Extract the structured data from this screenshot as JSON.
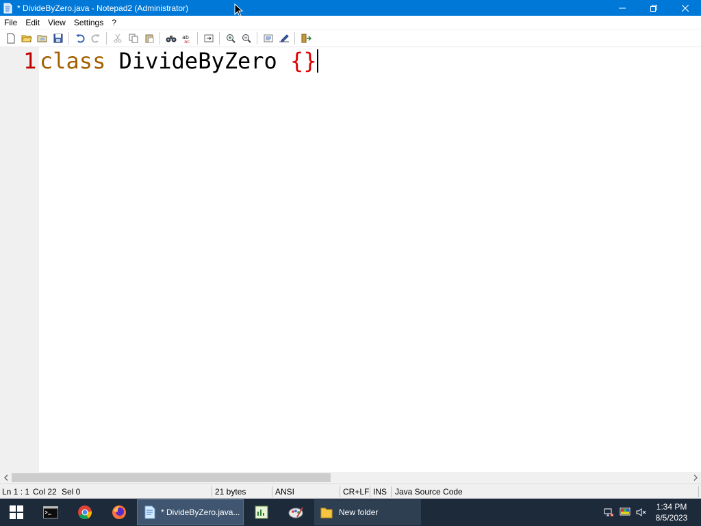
{
  "window": {
    "title": "* DivideByZero.java - Notepad2 (Administrator)",
    "controls": {
      "minimize_icon": "minimize-icon",
      "restore_icon": "restore-icon",
      "close_icon": "close-icon"
    }
  },
  "menu": [
    {
      "label": "File"
    },
    {
      "label": "Edit"
    },
    {
      "label": "View"
    },
    {
      "label": "Settings"
    },
    {
      "label": "?"
    }
  ],
  "toolbar": {
    "buttons": [
      "new",
      "open",
      "browse",
      "save",
      "undo",
      "redo",
      "cut",
      "copy",
      "paste",
      "find",
      "replace",
      "goto",
      "zoom-in",
      "zoom-out",
      "view-word-wrap",
      "settings-edit",
      "exit"
    ]
  },
  "editor": {
    "line_number": "1",
    "code": {
      "keyword": "class",
      "space1": " ",
      "identifier": "DivideByZero",
      "space2": " ",
      "brace_open": "{",
      "brace_close": "}"
    }
  },
  "statusbar": {
    "position": "Ln 1 : 1",
    "column": "Col 22",
    "selection": "Sel 0",
    "size": "21 bytes",
    "encoding": "ANSI",
    "line_endings": "CR+LF",
    "mode": "INS",
    "language": "Java Source Code"
  },
  "taskbar": {
    "tasks": [
      {
        "label": "* DivideByZero.java..."
      },
      {
        "label": "New folder"
      }
    ],
    "clock": {
      "time": "1:34 PM",
      "date": "8/5/2023"
    }
  },
  "colors": {
    "titlebar": "#0078d7",
    "keyword": "#a46000",
    "brace": "#e00000",
    "line_number": "#c00000",
    "taskbar": "#1d2a3a"
  }
}
